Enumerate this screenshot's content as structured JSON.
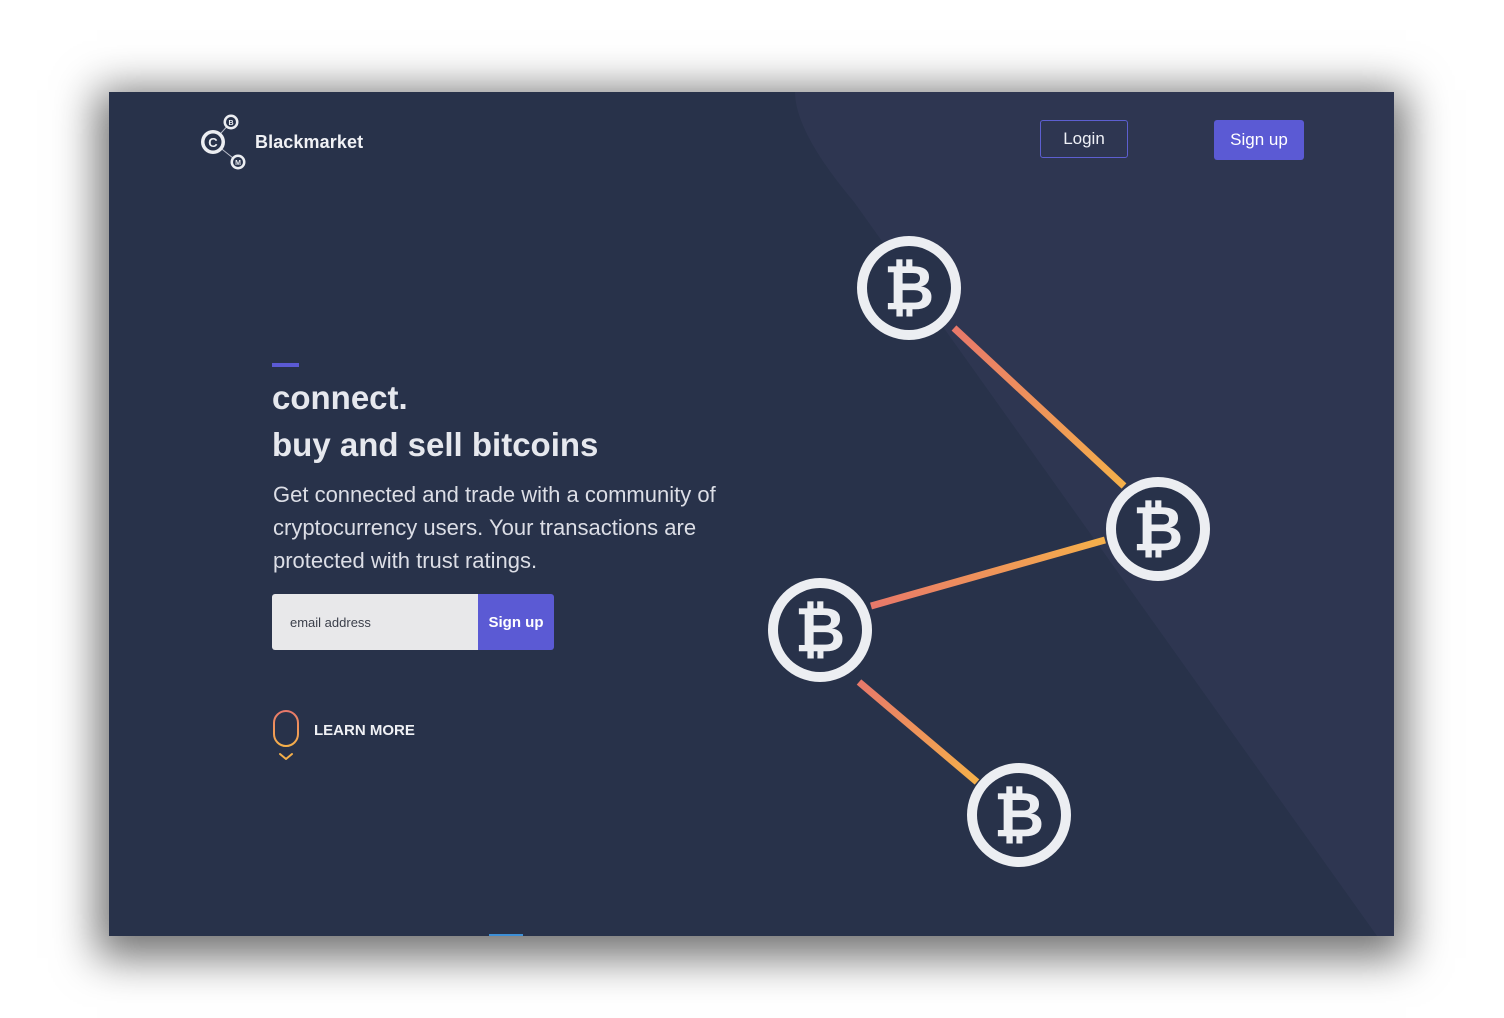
{
  "brand": {
    "name": "Blackmarket",
    "logo_letters": [
      "C",
      "B",
      "M"
    ]
  },
  "nav": {
    "login_label": "Login",
    "signup_label": "Sign up"
  },
  "hero": {
    "title_line1": "connect.",
    "title_line2": "buy and sell bitcoins",
    "description": "Get connected and trade with a community of cryptocurrency users. Your transactions are protected with trust ratings.",
    "email_placeholder": "email address",
    "signup_label": "Sign up",
    "learn_more_label": "LEARN MORE"
  },
  "illustration": {
    "coin_symbol": "₿",
    "coin_count": 4,
    "link_colors": [
      "#e8786a",
      "#f5b04a"
    ]
  },
  "colors": {
    "background": "#28324a",
    "accent": "#5b5ad4",
    "text": "#e6e8ee"
  },
  "icons": {
    "logo": "crypto-network-logo-icon",
    "mouse": "mouse-scroll-icon",
    "chevron": "chevron-down-icon",
    "coin": "bitcoin-icon"
  }
}
